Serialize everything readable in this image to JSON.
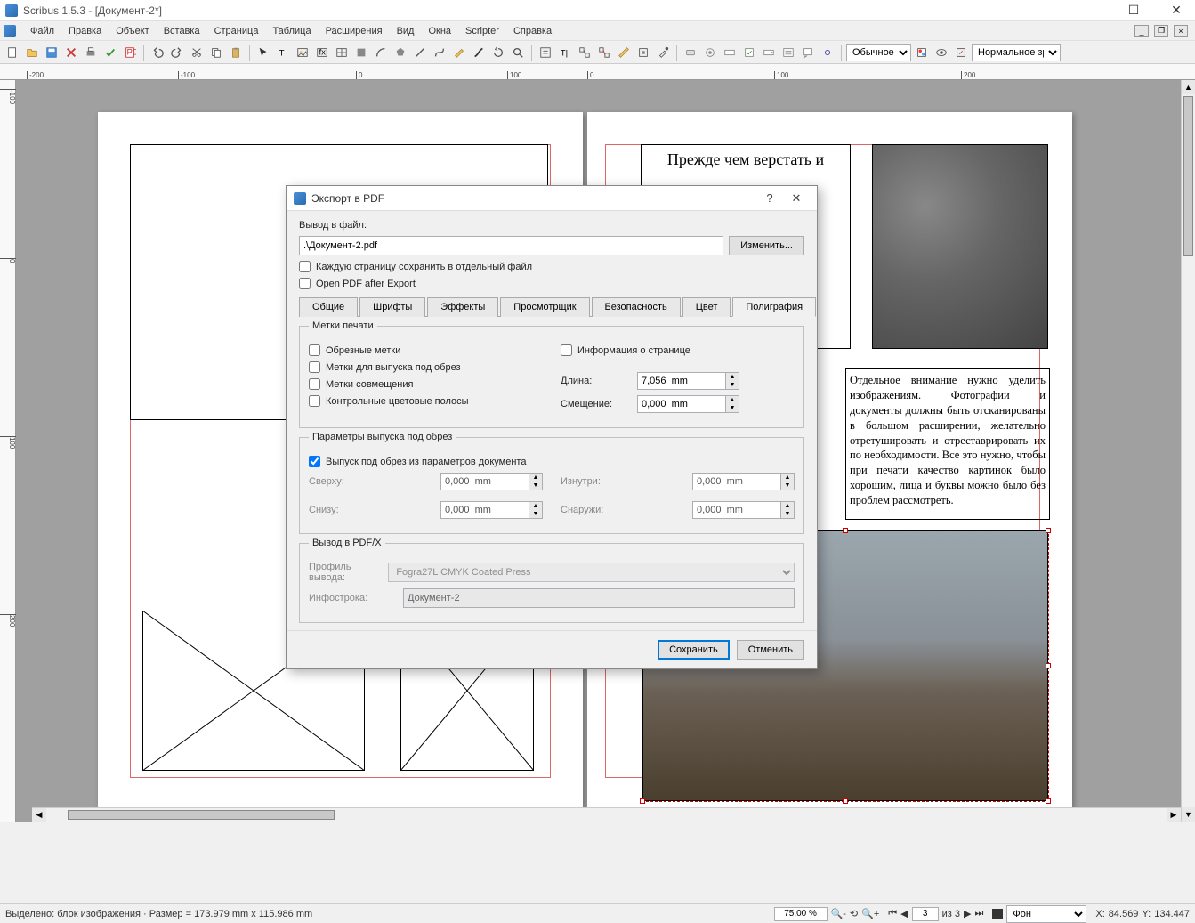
{
  "title": "Scribus 1.5.3 - [Документ-2*]",
  "menu": [
    "Файл",
    "Правка",
    "Объект",
    "Вставка",
    "Страница",
    "Таблица",
    "Расширения",
    "Вид",
    "Окна",
    "Scripter",
    "Справка"
  ],
  "toolbar": {
    "view_mode": "Обычное",
    "vision_mode": "Нормальное зрение"
  },
  "ruler_h": [
    "-200",
    "-100",
    "0",
    "100",
    "0",
    "100",
    "200"
  ],
  "ruler_v": [
    "-100",
    "0",
    "100",
    "200"
  ],
  "doc_text_top": "Прежде чем верстать и",
  "doc_text_body": "Отдельное внимание нужно уделить изображениям. Фотографии и документы должны быть отсканированы в большом расширении, желательно отретушировать и отреставрировать их по необходимости. Все это нужно, чтобы при печати качество картинок было хорошим, лица и буквы можно было без проблем рассмотреть.",
  "dialog": {
    "title": "Экспорт в PDF",
    "output_label": "Вывод в файл:",
    "output_value": ".\\Документ-2.pdf",
    "change_btn": "Изменить...",
    "save_pages_sep": "Каждую страницу сохранить в отдельный файл",
    "open_after": "Open PDF after Export",
    "tabs": [
      "Общие",
      "Шрифты",
      "Эффекты",
      "Просмотрщик",
      "Безопасность",
      "Цвет",
      "Полиграфия"
    ],
    "active_tab": 6,
    "sec_marks": "Метки печати",
    "marks": {
      "crop": "Обрезные метки",
      "bleed": "Метки для выпуска под обрез",
      "reg": "Метки совмещения",
      "color_bars": "Контрольные цветовые полосы",
      "page_info": "Информация о странице",
      "length_lbl": "Длина:",
      "length_val": "7,056  mm",
      "offset_lbl": "Смещение:",
      "offset_val": "0,000  mm"
    },
    "sec_bleed": "Параметры выпуска под обрез",
    "bleed": {
      "use_doc": "Выпуск под обрез из параметров документа",
      "top_lbl": "Сверху:",
      "top_val": "0,000  mm",
      "bottom_lbl": "Снизу:",
      "bottom_val": "0,000  mm",
      "inside_lbl": "Изнутри:",
      "inside_val": "0,000  mm",
      "outside_lbl": "Снаружи:",
      "outside_val": "0,000  mm"
    },
    "sec_pdfx": "Вывод в PDF/X",
    "pdfx": {
      "profile_lbl": "Профиль вывода:",
      "profile_val": "Fogra27L CMYK Coated Press",
      "info_lbl": "Инфострока:",
      "info_val": "Документ-2"
    },
    "save_btn": "Сохранить",
    "cancel_btn": "Отменить"
  },
  "status": {
    "left": "Выделено: блок изображения · Размер = 173.979  mm x 115.986  mm",
    "zoom": "75,00 %",
    "page": "3",
    "page_of": "из 3",
    "layer": "Фон",
    "x_lbl": "X:",
    "x_val": "84.569",
    "y_lbl": "Y:",
    "y_val": "134.447"
  }
}
